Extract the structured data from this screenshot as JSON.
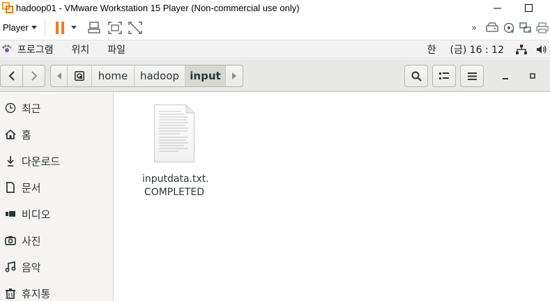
{
  "window": {
    "title": "hadoop01 - VMware Workstation 15 Player (Non-commercial use only)"
  },
  "vm_toolbar": {
    "player_menu": "Player"
  },
  "gnome_bar": {
    "menus": [
      "프로그램",
      "위치",
      "파일"
    ],
    "input_method": "한",
    "clock": "(금) 16 : 12"
  },
  "path_bar": {
    "crumbs": [
      "home",
      "hadoop",
      "input"
    ],
    "active_index": 2
  },
  "sidebar": {
    "items": [
      {
        "label": "최근",
        "icon": "clock-icon"
      },
      {
        "label": "홈",
        "icon": "home-icon"
      },
      {
        "label": "다운로드",
        "icon": "download-icon"
      },
      {
        "label": "문서",
        "icon": "document-icon"
      },
      {
        "label": "비디오",
        "icon": "video-icon"
      },
      {
        "label": "사진",
        "icon": "camera-icon"
      },
      {
        "label": "음악",
        "icon": "music-icon"
      },
      {
        "label": "휴지통",
        "icon": "trash-icon"
      }
    ]
  },
  "files": [
    {
      "name_line1": "inputdata.txt.",
      "name_line2": "COMPLETED",
      "icon": "text-file-icon"
    }
  ],
  "colors": {
    "pause_orange": "#f07b1d",
    "window_bg": "#ffffff",
    "sidebar_bg": "#f6f5f4",
    "header_bg": "#e8e8e7"
  }
}
